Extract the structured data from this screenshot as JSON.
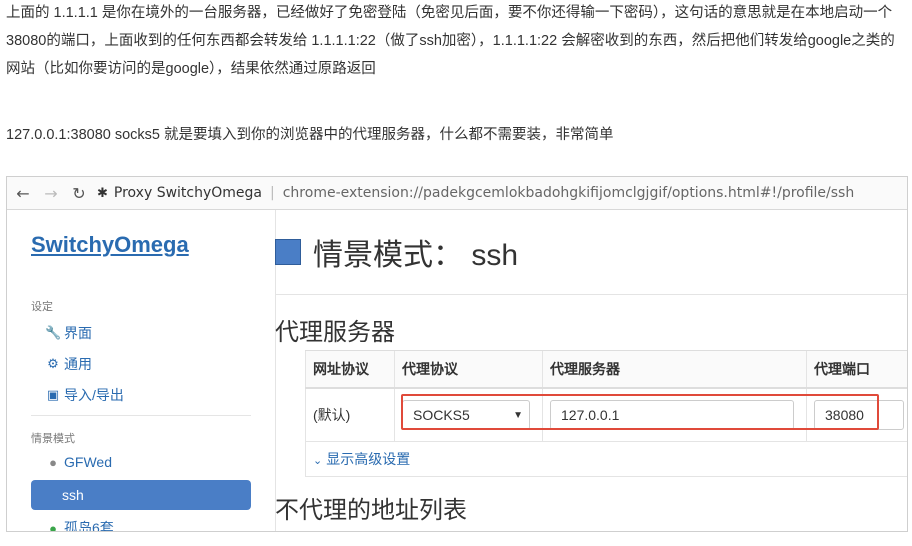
{
  "article": {
    "paragraph1": "上面的 1.1.1.1 是你在境外的一台服务器，已经做好了免密登陆（免密见后面，要不你还得输一下密码），这句话的意思就是在本地启动一个38080的端口，上面收到的任何东西都会转发给 1.1.1.1:22（做了ssh加密），1.1.1.1:22 会解密收到的东西，然后把他们转发给google之类的网站（比如你要访问的是google），结果依然通过原路返回",
    "paragraph2": "127.0.0.1:38080 socks5 就是要填入到你的浏览器中的代理服务器，什么都不需要装，非常简单"
  },
  "browser": {
    "back_icon": "arrow-left-icon",
    "forward_icon": "arrow-right-icon",
    "reload_icon": "reload-icon",
    "tab_title": "Proxy SwitchyOmega",
    "url": "chrome-extension://padekgcemlokbadohgkifijomclgjgif/options.html#!/profile/ssh"
  },
  "sidebar": {
    "brand": "SwitchyOmega",
    "settings_header": "设定",
    "settings_items": [
      {
        "label": "界面",
        "icon": "wrench-icon"
      },
      {
        "label": "通用",
        "icon": "gear-icon"
      },
      {
        "label": "导入/导出",
        "icon": "floppy-icon"
      }
    ],
    "profiles_header": "情景模式",
    "profiles": [
      {
        "label": "GFWed",
        "icon": "globe-icon"
      },
      {
        "label": "ssh",
        "active": true
      },
      {
        "label": "孤岛6套",
        "icon": "globe-icon"
      }
    ]
  },
  "main": {
    "title": "情景模式： ssh",
    "profile_color": "#4a7ec6",
    "proxy_section_title": "代理服务器",
    "table": {
      "headers": [
        "网址协议",
        "代理协议",
        "代理服务器",
        "代理端口"
      ],
      "row": {
        "scheme": "(默认)",
        "protocol": "SOCKS5",
        "server": "127.0.0.1",
        "port": "38080"
      },
      "advanced_link": "显示高级设置"
    },
    "bypass_section_title": "不代理的地址列表"
  },
  "colors": {
    "accent": "#4a7ec6",
    "link": "#2a6bb0",
    "highlight_box": "#e04a3a"
  }
}
